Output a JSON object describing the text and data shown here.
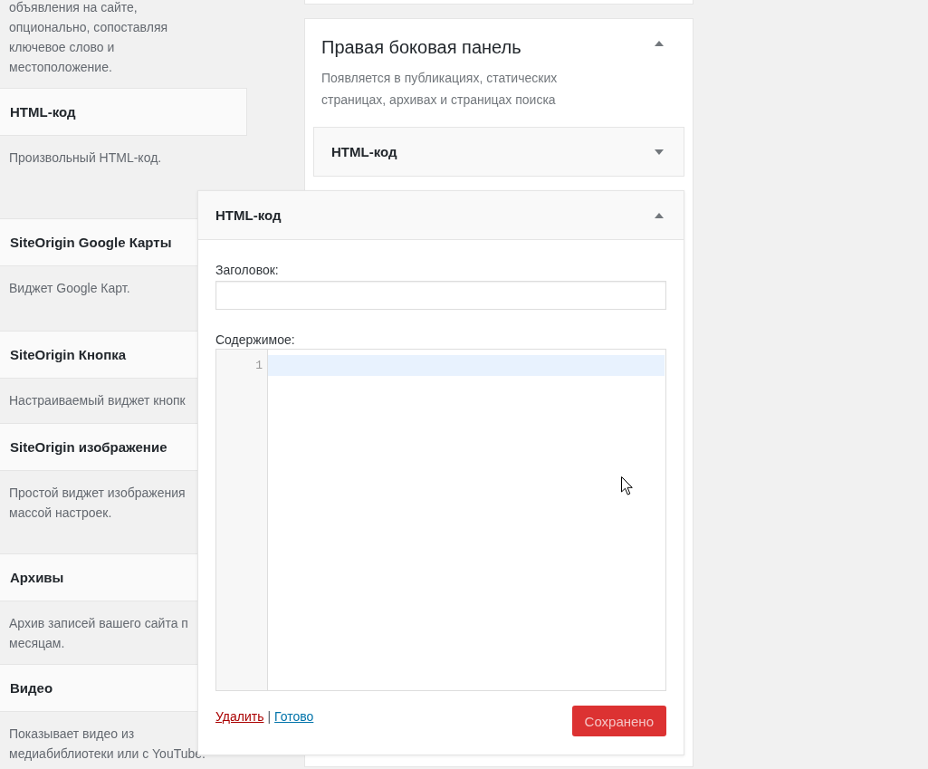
{
  "available_widgets": {
    "partial_description": "объявления на сайте, опционально, сопоставляя ключевое слово и местоположение.",
    "items": [
      {
        "title": "HTML-код",
        "description": "Произвольный HTML-код."
      },
      {
        "title": "SiteOrigin Google Карты",
        "description": "Виджет Google Карт."
      },
      {
        "title": "SiteOrigin Кнопка",
        "description": "Настраиваемый виджет кнопк"
      },
      {
        "title": "SiteOrigin изображение",
        "description": "Простой виджет изображения массой настроек."
      },
      {
        "title": "Архивы",
        "description": "Архив записей вашего сайта п месяцам."
      },
      {
        "title": "Видео",
        "description": "Показывает видео из медиабиблиотеки или с YouTube."
      }
    ]
  },
  "sidebar": {
    "title": "Правая боковая панель",
    "expanded": true,
    "description": "Появляется в публикациях, статических страницах, архивах и страницах поиска",
    "widgets": [
      {
        "title": "HTML-код",
        "expanded": false
      }
    ]
  },
  "dragged_widget": {
    "title": "HTML-код",
    "expanded": true,
    "fields": [
      {
        "kind": "text",
        "label": "Заголовок:"
      },
      {
        "kind": "code",
        "label": "Содержимое:",
        "lines": [
          {
            "number": "1",
            "active": true
          }
        ]
      }
    ],
    "links": [
      {
        "kind": "delete",
        "label": "Удалить"
      },
      {
        "kind": "done",
        "label": "Готово"
      }
    ],
    "separator": "|",
    "save_button": {
      "label": "Сохранено",
      "disabled": true
    }
  }
}
